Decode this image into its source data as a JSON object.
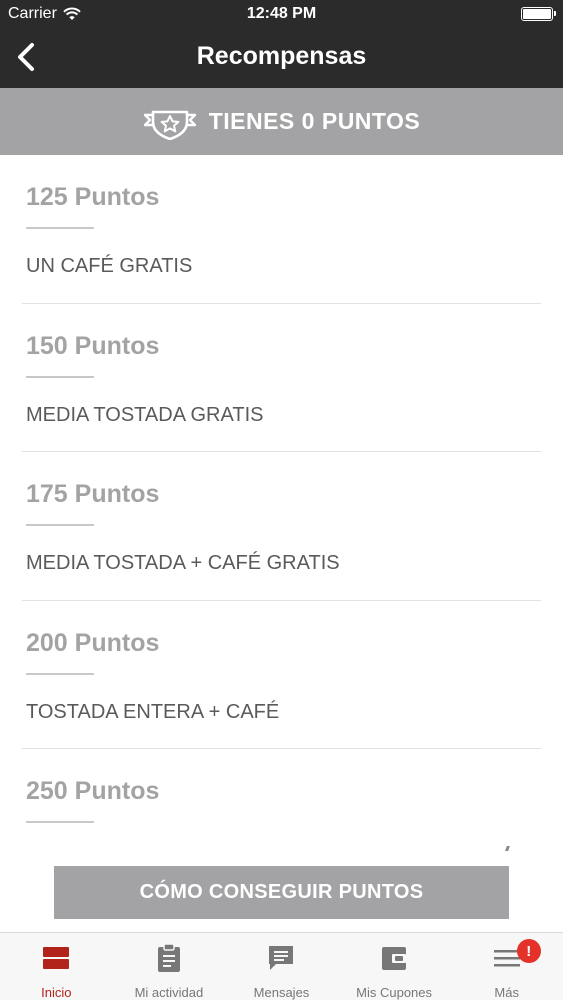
{
  "status_bar": {
    "carrier": "Carrier",
    "time": "12:48 PM"
  },
  "nav": {
    "title": "Recompensas",
    "back_icon": "chevron-left-icon"
  },
  "banner": {
    "text": "TIENES 0 PUNTOS",
    "icon": "badge-star-icon"
  },
  "rewards": [
    {
      "points": "125 Puntos",
      "description": "UN CAFÉ GRATIS"
    },
    {
      "points": "150 Puntos",
      "description": "MEDIA TOSTADA GRATIS"
    },
    {
      "points": "175 Puntos",
      "description": "MEDIA TOSTADA + CAFÉ GRATIS"
    },
    {
      "points": "200 Puntos",
      "description": "TOSTADA ENTERA + CAFÉ"
    },
    {
      "points": "250 Puntos",
      "description": ""
    }
  ],
  "cta": {
    "label": "CÓMO CONSEGUIR PUNTOS"
  },
  "tabs": [
    {
      "label": "Inicio",
      "icon": "home-icon",
      "active": true
    },
    {
      "label": "Mi actividad",
      "icon": "clipboard-icon",
      "active": false
    },
    {
      "label": "Mensajes",
      "icon": "message-icon",
      "active": false
    },
    {
      "label": "Mis Cupones",
      "icon": "wallet-icon",
      "active": false
    },
    {
      "label": "Más",
      "icon": "menu-icon",
      "active": false,
      "badge": "!"
    }
  ],
  "colors": {
    "accent": "#b2231b",
    "bar": "#2b2b2b",
    "banner": "#a3a3a5",
    "badge": "#e4312a"
  }
}
